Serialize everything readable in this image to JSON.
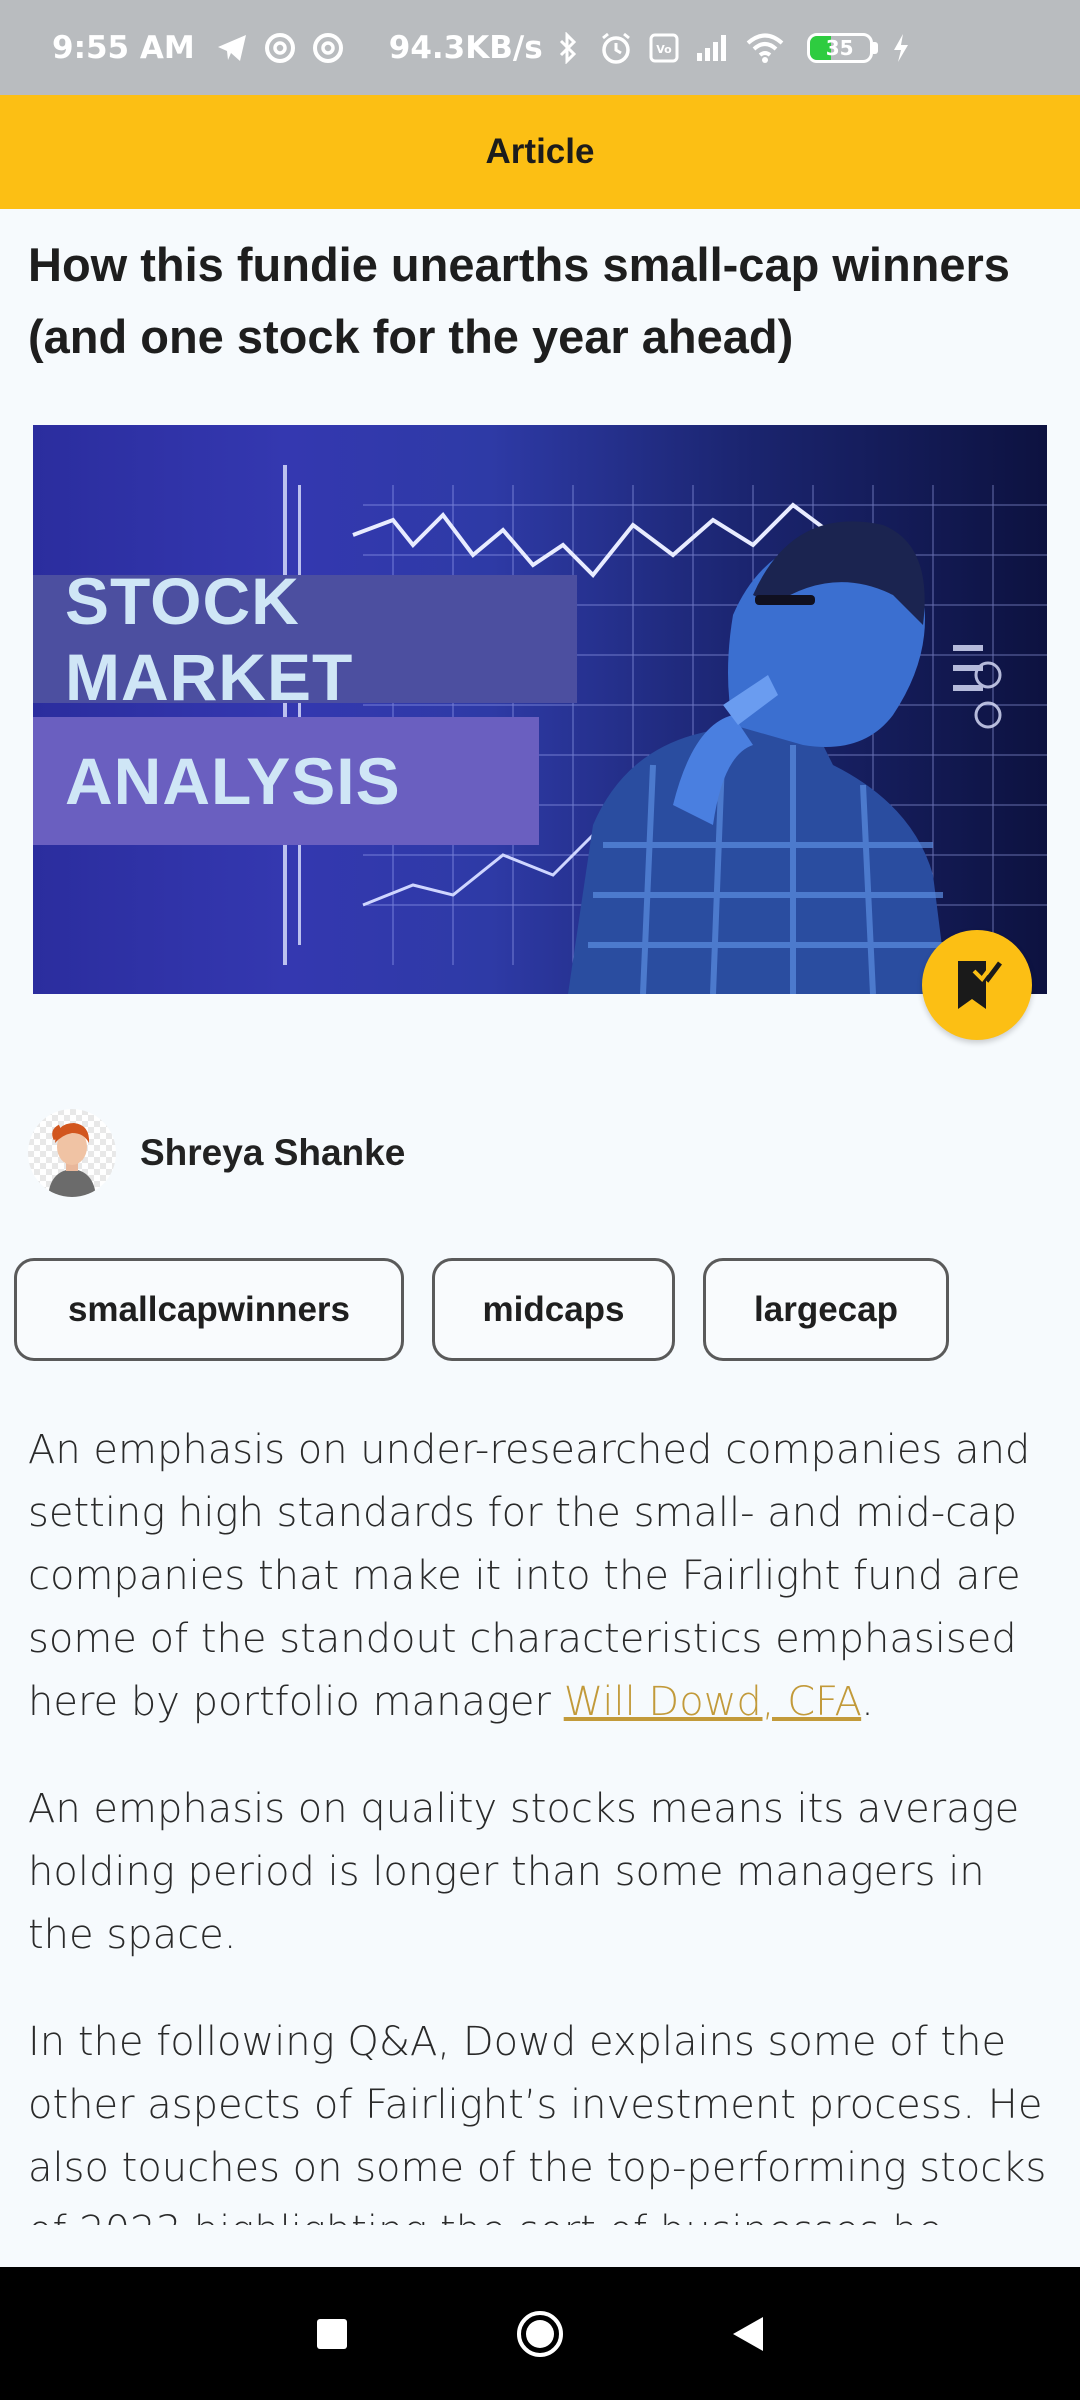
{
  "status_bar": {
    "time": "9:55 AM",
    "net_speed": "94.3KB/s",
    "battery_level": "35",
    "battery_fraction": 0.35,
    "icons": [
      "telegram-icon",
      "at-sign-icon",
      "at-sign-icon",
      "bluetooth-icon",
      "alarm-icon",
      "volte-icon",
      "signal-icon",
      "wifi-icon",
      "battery-icon",
      "charging-icon"
    ]
  },
  "app_bar": {
    "title": "Article"
  },
  "article": {
    "title": "How this fundie unearths small-cap winners (and one stock for the year ahead)",
    "hero": {
      "line1": "STOCK MARKET",
      "line2": "ANALYSIS"
    },
    "author": {
      "name": "Shreya Shanke"
    },
    "tags": [
      "smallcapwinners",
      "midcaps",
      "largecap"
    ],
    "paragraphs": {
      "p1_text": "An emphasis on under-researched companies and setting high standards for the small- and mid-cap companies that make it into the Fairlight fund are some of the standout characteristics emphasised here by portfolio manager ",
      "p1_link": "Will Dowd, CFA",
      "p1_end": ".",
      "p2": "An emphasis on quality stocks means its average holding period is longer than some managers in the space.",
      "p3": "In the following Q&A, Dowd explains some of the other aspects of Fairlight’s investment process. He also touches on some of the top-performing stocks of 2023 highlighting the sort of businesses he seeks."
    }
  },
  "colors": {
    "accent": "#fcbf14",
    "link": "#c29a3a",
    "background": "#f6fafd"
  }
}
